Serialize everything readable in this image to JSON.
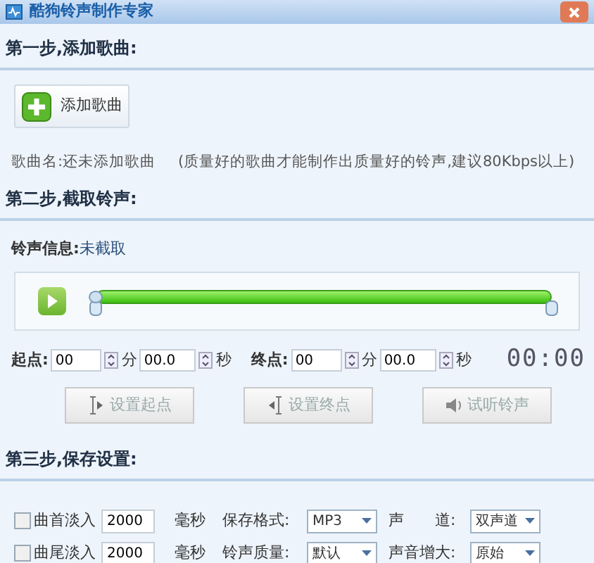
{
  "window": {
    "title": "酷狗铃声制作专家"
  },
  "step1": {
    "heading": "第一步,添加歌曲:",
    "add_button": "添加歌曲",
    "song_name": "歌曲名:还未添加歌曲",
    "hint": "(质量好的歌曲才能制作出质量好的铃声,建议80Kbps以上)"
  },
  "step2": {
    "heading": "第二步,截取铃声:",
    "info_label": "铃声信息:",
    "info_value": "未截取",
    "trim": {
      "start_handle": {
        "level": 0
      },
      "end_handle": {
        "level": 1
      }
    },
    "points": [
      {
        "label": "起点:",
        "minutes": "00",
        "min_unit": "分",
        "seconds": "00.0",
        "sec_unit": "秒"
      },
      {
        "label": "终点:",
        "minutes": "00",
        "min_unit": "分",
        "seconds": "00.0",
        "sec_unit": "秒"
      }
    ],
    "time_display": "00:00",
    "buttons": [
      {
        "label": "设置起点",
        "kind": "set-start",
        "disabled": true
      },
      {
        "label": "设置终点",
        "kind": "set-end",
        "disabled": true
      },
      {
        "label": "试听铃声",
        "kind": "preview",
        "disabled": true
      }
    ]
  },
  "step3": {
    "heading": "第三步,保存设置:",
    "rows": [
      {
        "label": "曲首淡入",
        "checked": false,
        "value": "2000",
        "unit": "毫秒",
        "selects": [
          {
            "label": "保存格式:",
            "value": "MP3"
          },
          {
            "label": "声　　道:",
            "value": "双声道"
          }
        ]
      },
      {
        "label": "曲尾淡入",
        "checked": false,
        "value": "2000",
        "unit": "毫秒",
        "selects": [
          {
            "label": "铃声质量:",
            "value": "默认"
          },
          {
            "label": "声音增大:",
            "value": "原始"
          }
        ]
      }
    ]
  }
}
